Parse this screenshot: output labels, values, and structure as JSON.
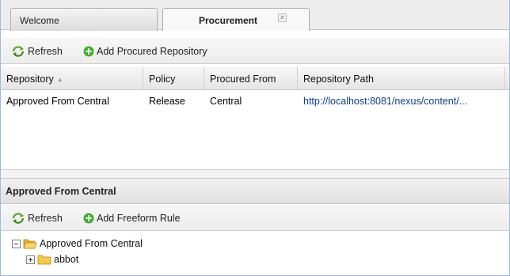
{
  "tabs": [
    {
      "label": "Welcome",
      "active": false
    },
    {
      "label": "Procurement",
      "active": true,
      "close_glyph": "×"
    }
  ],
  "toolbar_top": {
    "refresh_label": "Refresh",
    "add_label": "Add Procured Repository",
    "refresh_icon": "refresh-icon",
    "add_icon": "add-icon"
  },
  "grid": {
    "columns": [
      "Repository",
      "Policy",
      "Procured From",
      "Repository Path"
    ],
    "sort_indicator": "▲",
    "rows": [
      {
        "repository": "Approved From Central",
        "policy": "Release",
        "procured_from": "Central",
        "path": "http://localhost:8081/nexus/content/..."
      }
    ]
  },
  "details": {
    "title": "Approved From Central",
    "refresh_label": "Refresh",
    "add_label": "Add Freeform Rule",
    "tree": [
      {
        "label": "Approved From Central",
        "expanded": true,
        "depth": 0
      },
      {
        "label": "abbot",
        "expanded": false,
        "depth": 1
      }
    ]
  },
  "colors": {
    "accent": "#15428b",
    "refresh_green": "#5aa524",
    "add_green": "#3fae2a",
    "folder_yellow": "#f2c94c",
    "link": "#0b3f8a"
  }
}
